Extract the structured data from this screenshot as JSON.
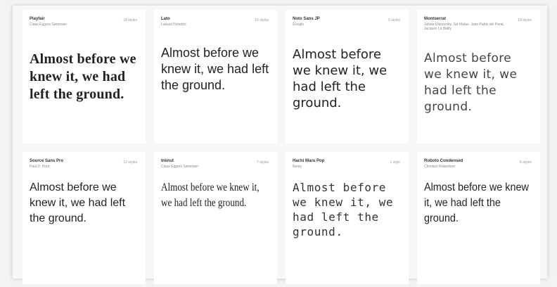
{
  "sample_text": "Almost before we knew it, we had left the ground.",
  "fonts": [
    {
      "name": "Playfair",
      "designer": "Claus Eggers Sørensen",
      "styles": "18 styles"
    },
    {
      "name": "Lato",
      "designer": "Łukasz Dziedzic",
      "styles": "10 styles"
    },
    {
      "name": "Noto Sans JP",
      "designer": "Google",
      "styles": "9 styles"
    },
    {
      "name": "Montserrat",
      "designer": "Julieta Ulanovsky, Sol Matas, Juan Pablo del Peral, Jacques Le Bailly",
      "styles": "18 styles"
    },
    {
      "name": "Source Sans Pro",
      "designer": "Paul D. Hunt",
      "styles": "12 styles"
    },
    {
      "name": "Inknut",
      "designer": "Claus Eggers Sørensen",
      "styles": "7 styles"
    },
    {
      "name": "Hachi Maru Pop",
      "designer": "Nonty",
      "styles": "1 style"
    },
    {
      "name": "Roboto Condensed",
      "designer": "Christian Robertson",
      "styles": "6 styles"
    }
  ]
}
